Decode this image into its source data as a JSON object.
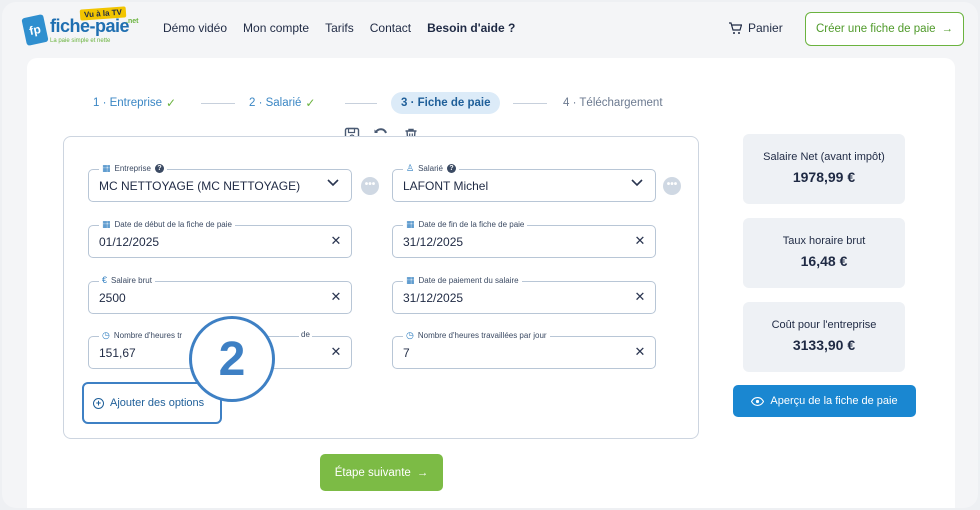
{
  "logo": {
    "badge": "Vu à la TV",
    "text": "fiche-paie",
    "suffix": ".net",
    "tagline": "La paie simple et nette",
    "mark": "fp"
  },
  "nav": {
    "items": [
      "Démo vidéo",
      "Mon compte",
      "Tarifs",
      "Contact",
      "Besoin d'aide ?"
    ]
  },
  "header": {
    "cart_label": "Panier",
    "cta_label": "Créer une fiche de paie"
  },
  "steps": [
    {
      "label": "1 · Entreprise",
      "state": "done"
    },
    {
      "label": "2 · Salarié",
      "state": "done"
    },
    {
      "label": "3 · Fiche de paie",
      "state": "active"
    },
    {
      "label": "4 · Téléchargement",
      "state": "pending"
    }
  ],
  "form": {
    "entreprise": {
      "label": "Entreprise",
      "value": "MC NETTOYAGE (MC NETTOYAGE)"
    },
    "salarie": {
      "label": "Salarié",
      "value": "LAFONT Michel"
    },
    "date_debut": {
      "label": "Date de début de la fiche de paie",
      "value": "01/12/2025"
    },
    "date_fin": {
      "label": "Date de fin de la fiche de paie",
      "value": "31/12/2025"
    },
    "salaire_brut": {
      "label": "Salaire brut",
      "value": "2500"
    },
    "date_paiement": {
      "label": "Date de paiement du salaire",
      "value": "31/12/2025"
    },
    "heures_mois": {
      "label_left": "Nombre d'heures tr",
      "label_right": "de",
      "value": "151,67"
    },
    "heures_jour": {
      "label": "Nombre d'heures travaillées par jour",
      "value": "7"
    },
    "add_options_label": "Ajouter des options",
    "next_label": "Étape suivante"
  },
  "annotation": {
    "number": "2"
  },
  "summary": {
    "net": {
      "title": "Salaire Net (avant impôt)",
      "value": "1978,99 €"
    },
    "taux": {
      "title": "Taux horaire brut",
      "value": "16,48 €"
    },
    "cout": {
      "title": "Coût pour l'entreprise",
      "value": "3133,90 €"
    },
    "preview_label": "Aperçu de la fiche de paie"
  },
  "colors": {
    "primary_blue": "#1a87d1",
    "brand_green": "#7cbb45",
    "annotation_blue": "#3e80c4"
  }
}
